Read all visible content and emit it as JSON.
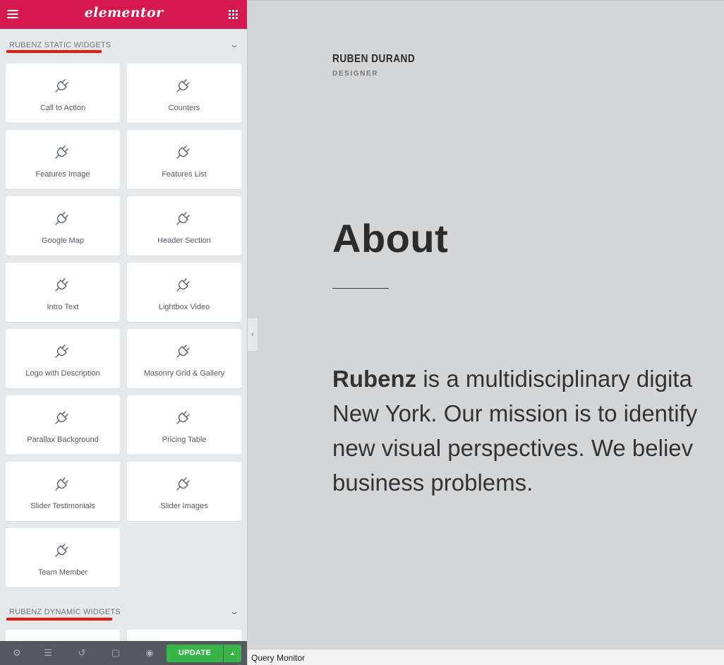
{
  "sidebar": {
    "brand": "elementor",
    "colors": {
      "brand": "#d5194f",
      "underline": "#e8180c",
      "update": "#39b54a"
    },
    "categories": [
      {
        "title": "RUBENZ STATIC WIDGETS",
        "widgets": [
          {
            "label": "Call to Action",
            "icon": "plug-icon"
          },
          {
            "label": "Counters",
            "icon": "plug-icon"
          },
          {
            "label": "Features Image",
            "icon": "plug-icon"
          },
          {
            "label": "Features List",
            "icon": "plug-icon"
          },
          {
            "label": "Google Map",
            "icon": "plug-icon"
          },
          {
            "label": "Header Section",
            "icon": "plug-icon"
          },
          {
            "label": "Intro Text",
            "icon": "plug-icon"
          },
          {
            "label": "Lightbox Video",
            "icon": "plug-icon"
          },
          {
            "label": "Logo with Description",
            "icon": "plug-icon"
          },
          {
            "label": "Masonry Grid & Gallery",
            "icon": "plug-icon"
          },
          {
            "label": "Parallax Background",
            "icon": "plug-icon"
          },
          {
            "label": "Pricing Table",
            "icon": "plug-icon"
          },
          {
            "label": "Slider Testimonials",
            "icon": "plug-icon"
          },
          {
            "label": "Slider Images",
            "icon": "plug-icon"
          },
          {
            "label": "Team Member",
            "icon": "plug-icon"
          }
        ]
      },
      {
        "title": "RUBENZ DYNAMIC WIDGETS",
        "widgets": []
      }
    ],
    "footer": {
      "icons": [
        "settings-icon",
        "layers-icon",
        "history-icon",
        "responsive-icon",
        "preview-icon"
      ],
      "update_label": "UPDATE"
    }
  },
  "preview": {
    "site_name": "RUBEN DURAND",
    "site_sub": "DESIGNER",
    "heading": "About",
    "intro_bold": "Rubenz",
    "intro_line1": " is a multidisciplinary digita",
    "intro_line2": "New York. Our mission is to identify",
    "intro_line3": "new visual perspectives. We believ",
    "intro_line4": "business problems."
  },
  "query_monitor": "Query Monitor"
}
